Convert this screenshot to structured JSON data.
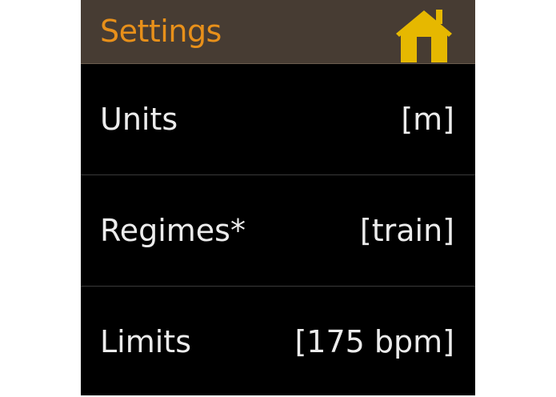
{
  "header": {
    "title": "Settings",
    "home_icon": "home-icon",
    "accent_color": "#e8901a",
    "home_icon_color": "#e6b800"
  },
  "settings": [
    {
      "label": "Units",
      "value": "[m]"
    },
    {
      "label": "Regimes*",
      "value": "[train]"
    },
    {
      "label": "Limits",
      "value": "[175 bpm]"
    }
  ]
}
